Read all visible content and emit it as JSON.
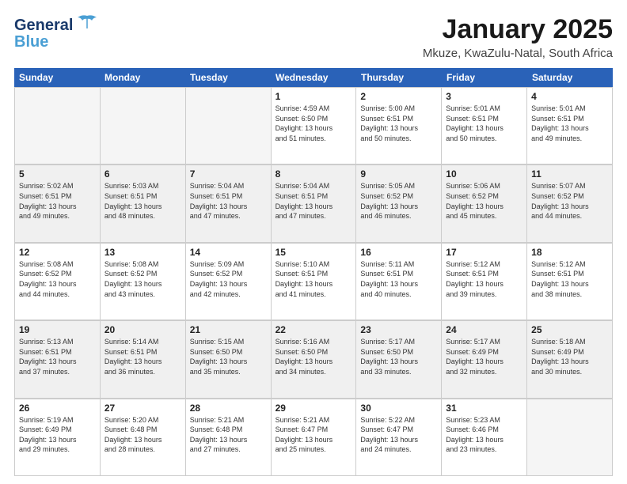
{
  "header": {
    "logo_general": "General",
    "logo_blue": "Blue",
    "title": "January 2025",
    "subtitle": "Mkuze, KwaZulu-Natal, South Africa"
  },
  "days": [
    "Sunday",
    "Monday",
    "Tuesday",
    "Wednesday",
    "Thursday",
    "Friday",
    "Saturday"
  ],
  "weeks": [
    [
      {
        "day": "",
        "empty": true
      },
      {
        "day": "",
        "empty": true
      },
      {
        "day": "",
        "empty": true
      },
      {
        "day": "1",
        "info": "Sunrise: 4:59 AM\nSunset: 6:50 PM\nDaylight: 13 hours\nand 51 minutes."
      },
      {
        "day": "2",
        "info": "Sunrise: 5:00 AM\nSunset: 6:51 PM\nDaylight: 13 hours\nand 50 minutes."
      },
      {
        "day": "3",
        "info": "Sunrise: 5:01 AM\nSunset: 6:51 PM\nDaylight: 13 hours\nand 50 minutes."
      },
      {
        "day": "4",
        "info": "Sunrise: 5:01 AM\nSunset: 6:51 PM\nDaylight: 13 hours\nand 49 minutes."
      }
    ],
    [
      {
        "day": "5",
        "info": "Sunrise: 5:02 AM\nSunset: 6:51 PM\nDaylight: 13 hours\nand 49 minutes."
      },
      {
        "day": "6",
        "info": "Sunrise: 5:03 AM\nSunset: 6:51 PM\nDaylight: 13 hours\nand 48 minutes."
      },
      {
        "day": "7",
        "info": "Sunrise: 5:04 AM\nSunset: 6:51 PM\nDaylight: 13 hours\nand 47 minutes."
      },
      {
        "day": "8",
        "info": "Sunrise: 5:04 AM\nSunset: 6:51 PM\nDaylight: 13 hours\nand 47 minutes."
      },
      {
        "day": "9",
        "info": "Sunrise: 5:05 AM\nSunset: 6:52 PM\nDaylight: 13 hours\nand 46 minutes."
      },
      {
        "day": "10",
        "info": "Sunrise: 5:06 AM\nSunset: 6:52 PM\nDaylight: 13 hours\nand 45 minutes."
      },
      {
        "day": "11",
        "info": "Sunrise: 5:07 AM\nSunset: 6:52 PM\nDaylight: 13 hours\nand 44 minutes."
      }
    ],
    [
      {
        "day": "12",
        "info": "Sunrise: 5:08 AM\nSunset: 6:52 PM\nDaylight: 13 hours\nand 44 minutes."
      },
      {
        "day": "13",
        "info": "Sunrise: 5:08 AM\nSunset: 6:52 PM\nDaylight: 13 hours\nand 43 minutes."
      },
      {
        "day": "14",
        "info": "Sunrise: 5:09 AM\nSunset: 6:52 PM\nDaylight: 13 hours\nand 42 minutes."
      },
      {
        "day": "15",
        "info": "Sunrise: 5:10 AM\nSunset: 6:51 PM\nDaylight: 13 hours\nand 41 minutes."
      },
      {
        "day": "16",
        "info": "Sunrise: 5:11 AM\nSunset: 6:51 PM\nDaylight: 13 hours\nand 40 minutes."
      },
      {
        "day": "17",
        "info": "Sunrise: 5:12 AM\nSunset: 6:51 PM\nDaylight: 13 hours\nand 39 minutes."
      },
      {
        "day": "18",
        "info": "Sunrise: 5:12 AM\nSunset: 6:51 PM\nDaylight: 13 hours\nand 38 minutes."
      }
    ],
    [
      {
        "day": "19",
        "info": "Sunrise: 5:13 AM\nSunset: 6:51 PM\nDaylight: 13 hours\nand 37 minutes."
      },
      {
        "day": "20",
        "info": "Sunrise: 5:14 AM\nSunset: 6:51 PM\nDaylight: 13 hours\nand 36 minutes."
      },
      {
        "day": "21",
        "info": "Sunrise: 5:15 AM\nSunset: 6:50 PM\nDaylight: 13 hours\nand 35 minutes."
      },
      {
        "day": "22",
        "info": "Sunrise: 5:16 AM\nSunset: 6:50 PM\nDaylight: 13 hours\nand 34 minutes."
      },
      {
        "day": "23",
        "info": "Sunrise: 5:17 AM\nSunset: 6:50 PM\nDaylight: 13 hours\nand 33 minutes."
      },
      {
        "day": "24",
        "info": "Sunrise: 5:17 AM\nSunset: 6:49 PM\nDaylight: 13 hours\nand 32 minutes."
      },
      {
        "day": "25",
        "info": "Sunrise: 5:18 AM\nSunset: 6:49 PM\nDaylight: 13 hours\nand 30 minutes."
      }
    ],
    [
      {
        "day": "26",
        "info": "Sunrise: 5:19 AM\nSunset: 6:49 PM\nDaylight: 13 hours\nand 29 minutes."
      },
      {
        "day": "27",
        "info": "Sunrise: 5:20 AM\nSunset: 6:48 PM\nDaylight: 13 hours\nand 28 minutes."
      },
      {
        "day": "28",
        "info": "Sunrise: 5:21 AM\nSunset: 6:48 PM\nDaylight: 13 hours\nand 27 minutes."
      },
      {
        "day": "29",
        "info": "Sunrise: 5:21 AM\nSunset: 6:47 PM\nDaylight: 13 hours\nand 25 minutes."
      },
      {
        "day": "30",
        "info": "Sunrise: 5:22 AM\nSunset: 6:47 PM\nDaylight: 13 hours\nand 24 minutes."
      },
      {
        "day": "31",
        "info": "Sunrise: 5:23 AM\nSunset: 6:46 PM\nDaylight: 13 hours\nand 23 minutes."
      },
      {
        "day": "",
        "empty": true
      }
    ]
  ]
}
